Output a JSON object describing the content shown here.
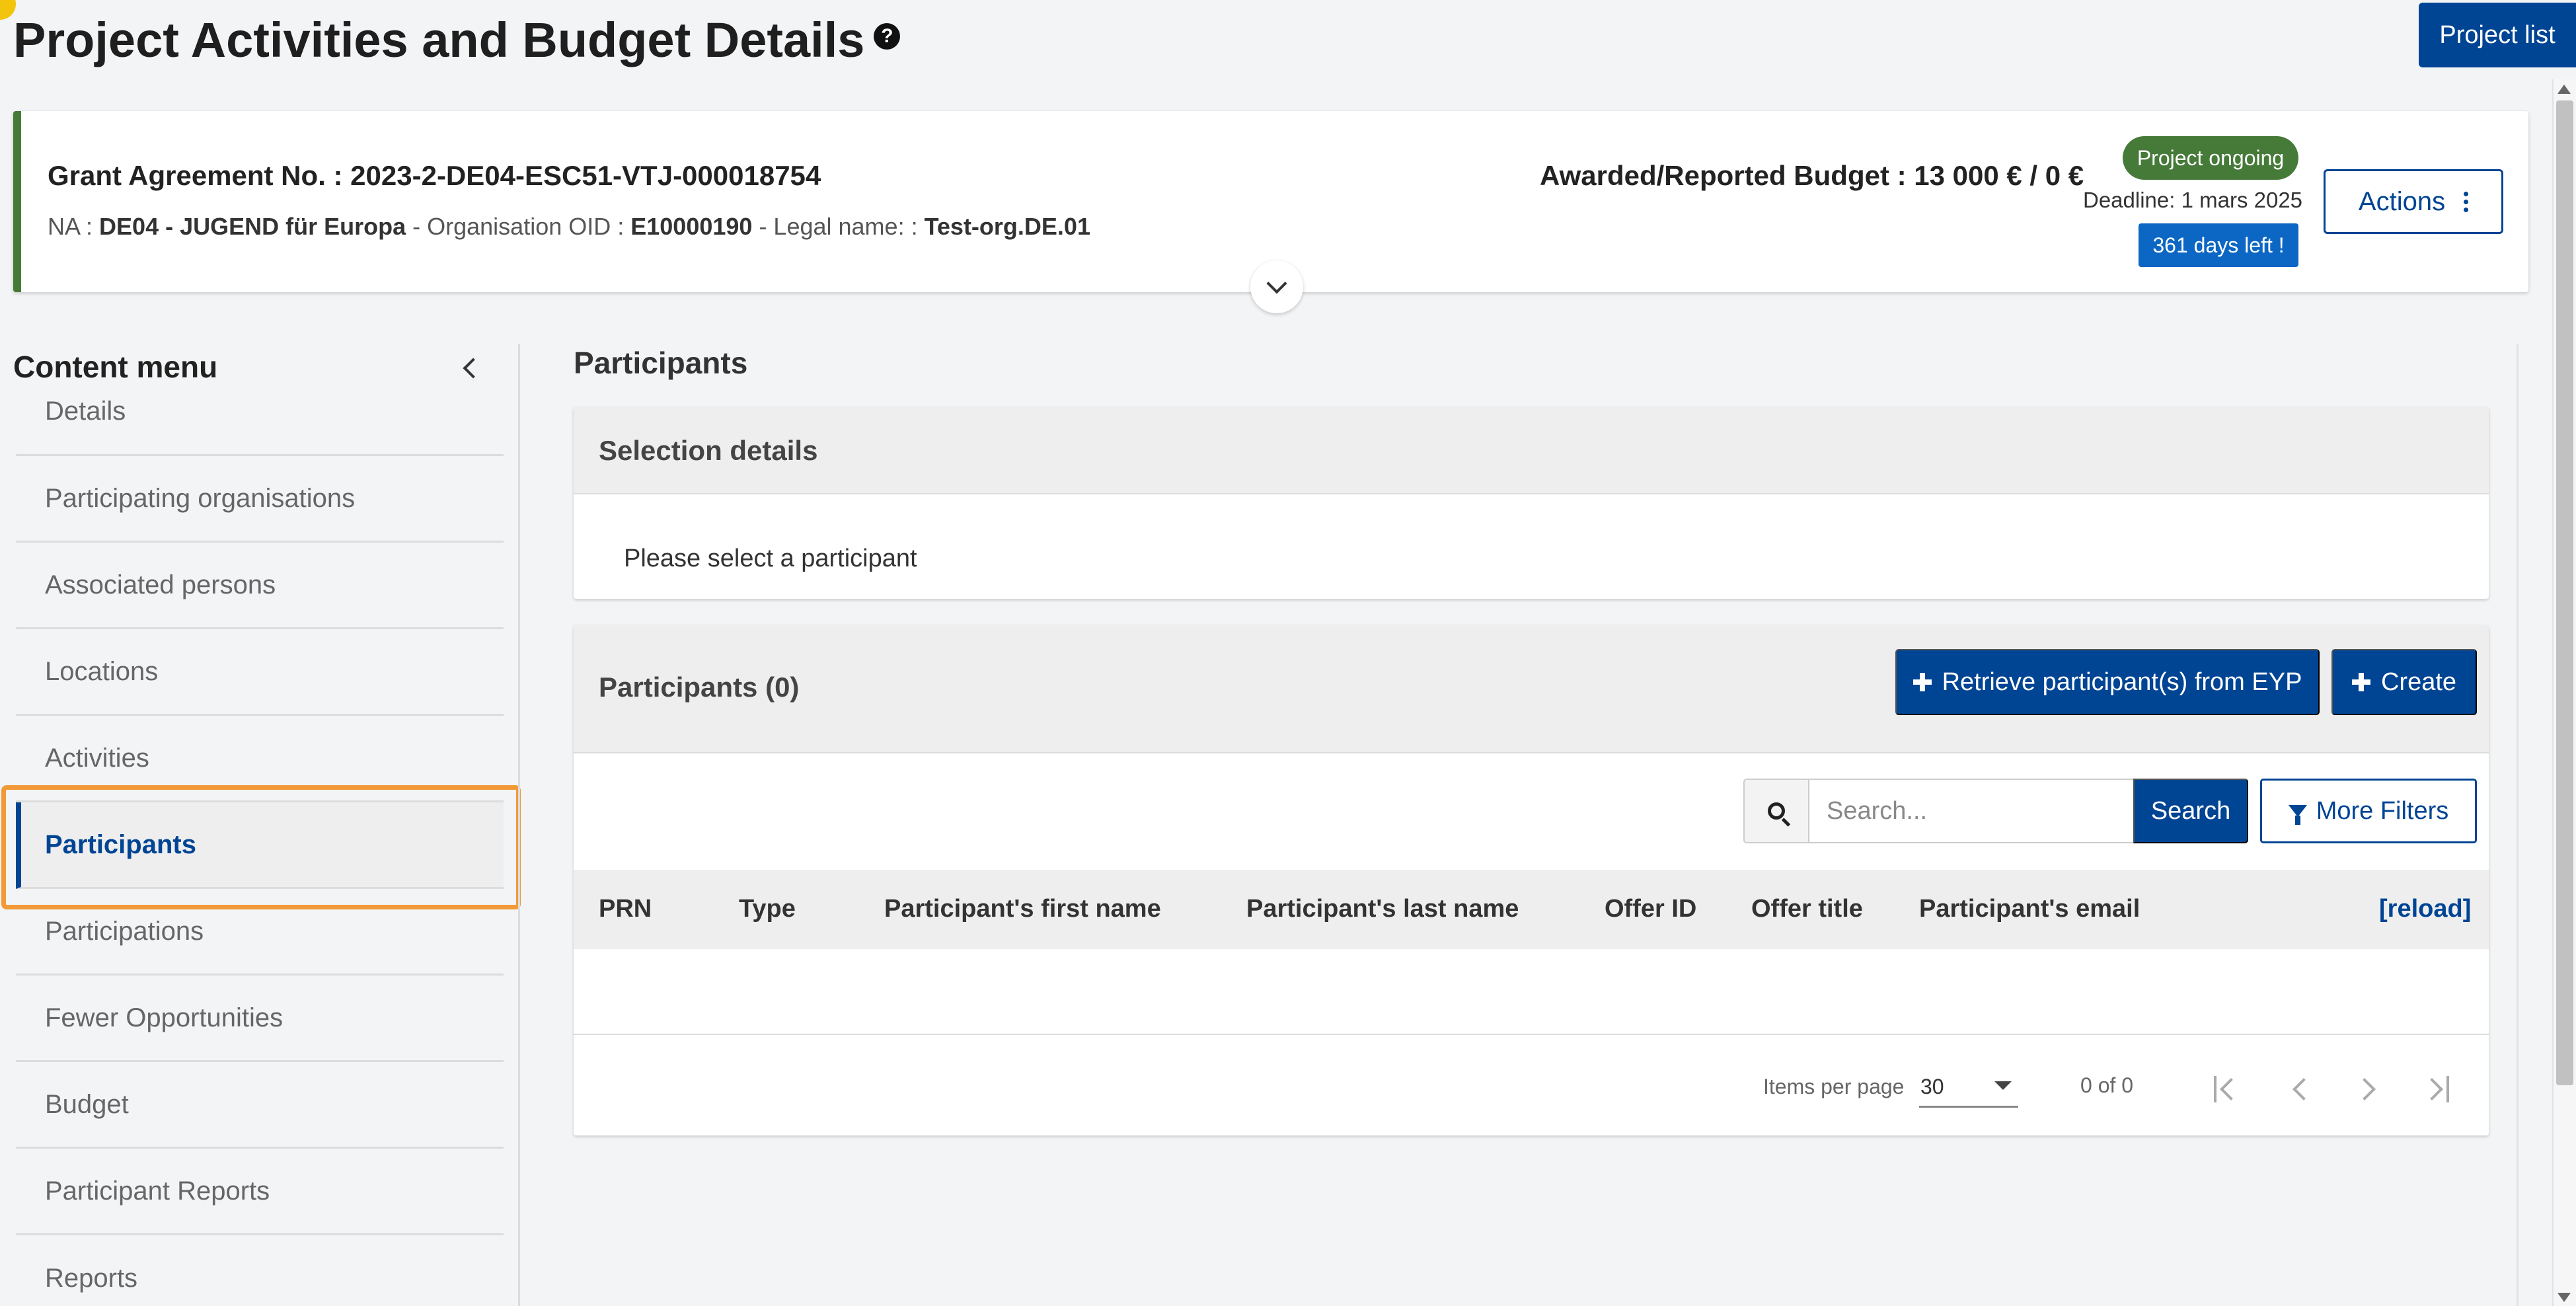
{
  "header": {
    "title": "Project Activities and Budget Details",
    "help_icon": "question-circle-icon",
    "project_list_label": "Project list"
  },
  "grant": {
    "agreement_label": "Grant Agreement No. : 2023-2-DE04-ESC51-VTJ-000018754",
    "na_label": "NA : ",
    "na_value": "DE04 - JUGEND für Europa",
    "oid_label": " - Organisation OID : ",
    "oid_value": "E10000190",
    "legal_label": " - Legal name: : ",
    "legal_value": "Test-org.DE.01",
    "budget": "Awarded/Reported Budget : 13 000 € / 0 €",
    "status": "Project ongoing",
    "deadline": "Deadline: 1 mars 2025",
    "days_left": "361 days left !",
    "actions_label": "Actions",
    "status_color": "#467a39",
    "accent_color": "#004494"
  },
  "sidebar": {
    "title": "Content menu",
    "items": [
      {
        "label": "Details"
      },
      {
        "label": "Participating organisations"
      },
      {
        "label": "Associated persons"
      },
      {
        "label": "Locations"
      },
      {
        "label": "Activities"
      },
      {
        "label": "Participants",
        "active": true
      },
      {
        "label": "Participations"
      },
      {
        "label": "Fewer Opportunities"
      },
      {
        "label": "Budget"
      },
      {
        "label": "Participant Reports"
      },
      {
        "label": "Reports"
      }
    ]
  },
  "main": {
    "section_title": "Participants",
    "selection": {
      "title": "Selection details",
      "placeholder": "Please select a participant"
    },
    "participants": {
      "title": "Participants (0)",
      "retrieve_label": "Retrieve participant(s) from EYP",
      "create_label": "Create",
      "search_placeholder": "Search...",
      "search_label": "Search",
      "filters_label": "More Filters",
      "columns": [
        "PRN",
        "Type",
        "Participant's first name",
        "Participant's last name",
        "Offer ID",
        "Offer title",
        "Participant's email"
      ],
      "reload_label": "[reload]",
      "items_per_page_label": "Items per page",
      "items_per_page_value": "30",
      "range_label": "0 of 0"
    }
  }
}
